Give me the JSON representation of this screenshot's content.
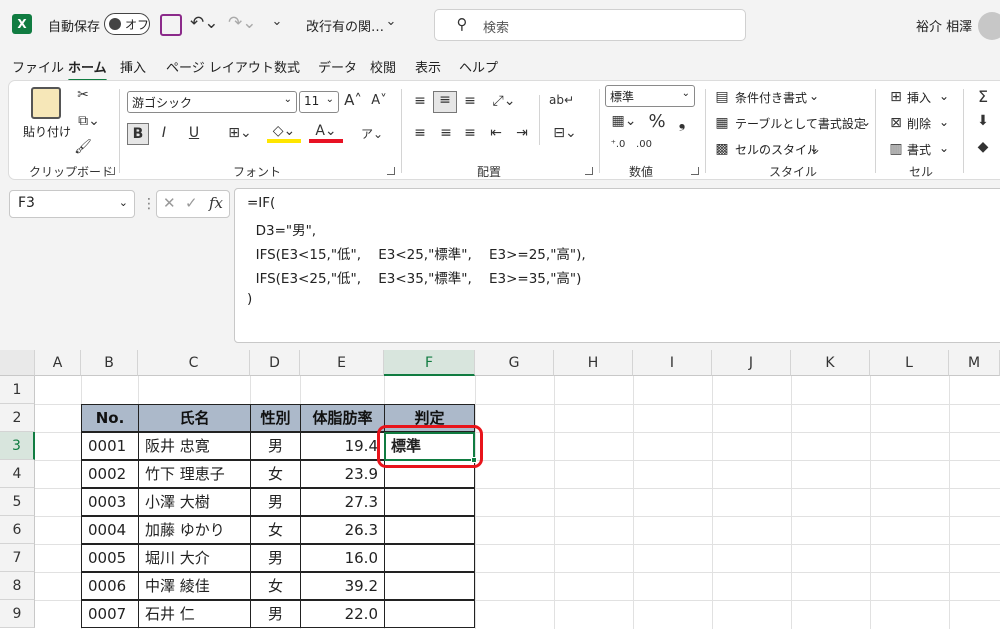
{
  "titlebar": {
    "autosave_label": "自動保存",
    "autosave_state": "オフ",
    "filename": "改行有の関…",
    "search_placeholder": "検索",
    "user_name": "裕介 相澤"
  },
  "tabs": [
    "ファイル",
    "ホーム",
    "挿入",
    "ページ レイアウト",
    "数式",
    "データ",
    "校閲",
    "表示",
    "ヘルプ"
  ],
  "active_tab": "ホーム",
  "ribbon": {
    "clipboard": {
      "label": "クリップボード",
      "paste": "貼り付け"
    },
    "font": {
      "label": "フォント",
      "family": "游ゴシック",
      "size": "11",
      "bold": "B",
      "italic": "I",
      "underline": "U"
    },
    "alignment": {
      "label": "配置"
    },
    "number": {
      "label": "数値",
      "format": "標準",
      "percent": "%",
      "comma": "❟"
    },
    "styles": {
      "label": "スタイル",
      "conditional": "条件付き書式",
      "table": "テーブルとして書式設定",
      "cell_styles": "セルのスタイル"
    },
    "cells": {
      "label": "セル",
      "insert": "挿入",
      "delete": "削除",
      "format": "書式"
    }
  },
  "formula_bar": {
    "name_box": "F3",
    "fx": "fx",
    "lines": [
      "=IF(",
      "  D3=\"男\",",
      "  IFS(E3<15,\"低\",    E3<25,\"標準\",    E3>=25,\"高\"),",
      "  IFS(E3<25,\"低\",    E3<35,\"標準\",    E3>=35,\"高\")",
      ")"
    ]
  },
  "sheet": {
    "columns": [
      "A",
      "B",
      "C",
      "D",
      "E",
      "F",
      "G",
      "H",
      "I",
      "J",
      "K",
      "L",
      "M"
    ],
    "rows": [
      "1",
      "2",
      "3",
      "4",
      "5",
      "6",
      "7",
      "8",
      "9"
    ],
    "selected_column": "F",
    "selected_row": "3",
    "table_headers": [
      "No.",
      "氏名",
      "性別",
      "体脂肪率",
      "判定"
    ],
    "table_rows": [
      [
        "0001",
        "阪井 忠寛",
        "男",
        "19.4",
        "標準"
      ],
      [
        "0002",
        "竹下 理恵子",
        "女",
        "23.9",
        ""
      ],
      [
        "0003",
        "小澤 大樹",
        "男",
        "27.3",
        ""
      ],
      [
        "0004",
        "加藤 ゆかり",
        "女",
        "26.3",
        ""
      ],
      [
        "0005",
        "堀川 大介",
        "男",
        "16.0",
        ""
      ],
      [
        "0006",
        "中澤 綾佳",
        "女",
        "39.2",
        ""
      ],
      [
        "0007",
        "石井 仁",
        "男",
        "22.0",
        ""
      ]
    ]
  },
  "colors": {
    "excel_green": "#107c41",
    "header_fill": "#acb9ca",
    "highlight": "#e8141b"
  }
}
